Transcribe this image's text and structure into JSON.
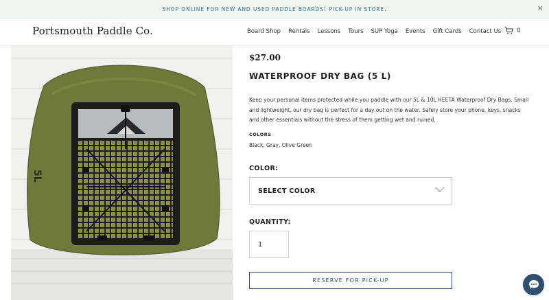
{
  "announcement": {
    "text": "SHOP ONLINE FOR NEW AND USED PADDLE BOARDS! PICK-UP IN STORE.",
    "close_label": "×"
  },
  "header": {
    "logo": "Portsmouth Paddle Co.",
    "nav": [
      "Board Shop",
      "Rentals",
      "Lessons",
      "Tours",
      "SUP Yoga",
      "Events",
      "Gift Cards",
      "Contact Us"
    ],
    "cart_count": "0"
  },
  "product": {
    "image_label": "5L",
    "price": "$27.00",
    "title": "WATERPROOF DRY BAG (5 L)",
    "description": "Keep your personal items protected while you paddle with our 5L & 10L HEETA Waterproof Dry Bags. Small and lightweight, our dry bag is perfect for a day out on the water. Safely store your phone, keys, snacks and other essentials without the stress of them getting wet and ruined.",
    "colors_heading": "COLORS",
    "colors_value": "Black, Gray, Olive Green"
  },
  "form": {
    "color_label": "COLOR:",
    "color_selected": "SELECT COLOR",
    "quantity_label": "QUANTITY:",
    "quantity_value": "1",
    "reserve_label": "RESERVE FOR PICK-UP"
  },
  "colors": {
    "accent": "#2e4f6e",
    "announcement_bg": "#eef6f1",
    "announcement_text": "#3d6f87",
    "bag_olive": "#6f7a3a"
  },
  "icons": {
    "cart": "cart-icon",
    "chevron": "chevron-down-icon",
    "chat": "chat-icon",
    "close": "close-icon"
  }
}
